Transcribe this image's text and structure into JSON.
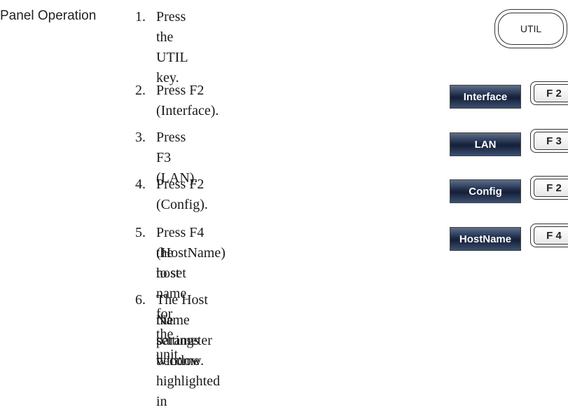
{
  "section_label": "Panel Operation",
  "util_key_label": "UTIL",
  "steps": [
    {
      "num": "1.",
      "lines": [
        "Press the UTIL key."
      ]
    },
    {
      "num": "2.",
      "lines": [
        "Press F2 (Interface)."
      ],
      "softkey": "Interface",
      "fkey": "F 2"
    },
    {
      "num": "3.",
      "lines": [
        "Press F3 (LAN)."
      ],
      "softkey": "LAN",
      "fkey": "F 3"
    },
    {
      "num": "4.",
      "lines": [
        "Press F2 (Config)."
      ],
      "softkey": "Config",
      "fkey": "F 2"
    },
    {
      "num": "5.",
      "lines": [
        "Press F4 (HostName) to set",
        "the host name for the unit."
      ],
      "softkey": "HostName",
      "fkey": "F 4"
    },
    {
      "num": "6.",
      "lines": [
        "The Host Name settings become highlighted in",
        "the parameter window."
      ]
    }
  ]
}
